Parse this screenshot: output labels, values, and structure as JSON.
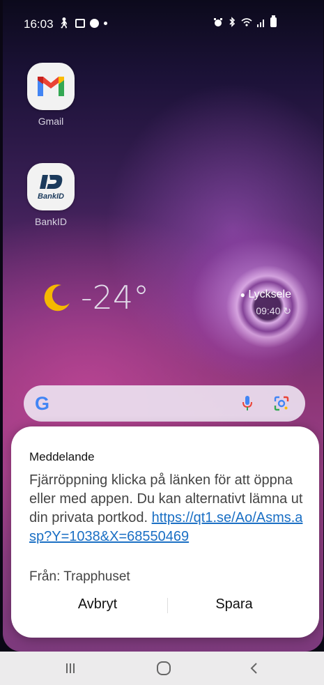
{
  "status_bar": {
    "time": "16:03",
    "left_icons": [
      "walking-icon",
      "image-icon",
      "face-icon",
      "dot-icon"
    ],
    "right_icons": [
      "alarm-icon",
      "bluetooth-icon",
      "wifi-icon",
      "signal-icon",
      "battery-icon"
    ]
  },
  "home": {
    "apps": [
      {
        "label": "Gmail",
        "icon": "gmail-icon"
      },
      {
        "label": "BankID",
        "icon": "bankid-icon",
        "icon_text": "BankID"
      }
    ],
    "weather": {
      "temperature": "-24°",
      "city": "Lycksele",
      "updated_time": "09:40"
    },
    "search_bar": {
      "logo": "G"
    }
  },
  "dialog": {
    "title": "Meddelande",
    "body_text": "Fjärröppning  klicka på länken för att öppna eller med appen. Du kan alternativt lämna ut din privata portkod. ",
    "link": "https://qt1.se/Ao/Asms.asp?Y=1038&X=68550469",
    "from": "Från: Trapphuset",
    "cancel_label": "Avbryt",
    "save_label": "Spara"
  },
  "navigation": {
    "buttons": [
      "recents-icon",
      "home-icon",
      "back-icon"
    ]
  },
  "colors": {
    "link": "#1a6fc4",
    "dialog_bg": "#ffffff",
    "nav_bg": "#ecebec"
  }
}
